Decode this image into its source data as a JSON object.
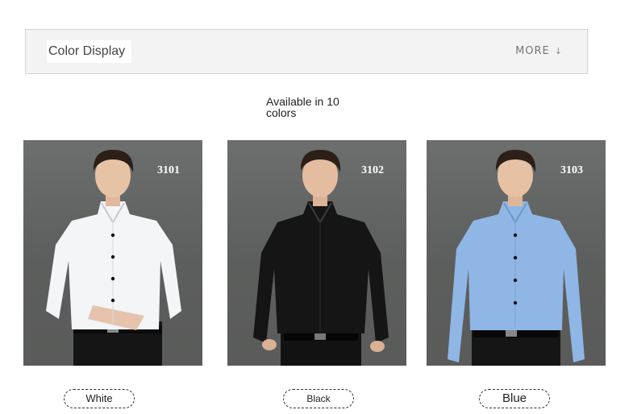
{
  "header": {
    "title": "Color Display",
    "more_label": "MORE",
    "more_icon": "down-arrow-icon"
  },
  "available_text": "Available in 10 colors",
  "products": [
    {
      "code": "3101",
      "color_name": "White",
      "shirt_color": "#f4f5f7"
    },
    {
      "code": "3102",
      "color_name": "Black",
      "shirt_color": "#151515"
    },
    {
      "code": "3103",
      "color_name": "Blue",
      "shirt_color": "#8fb6e4"
    }
  ]
}
